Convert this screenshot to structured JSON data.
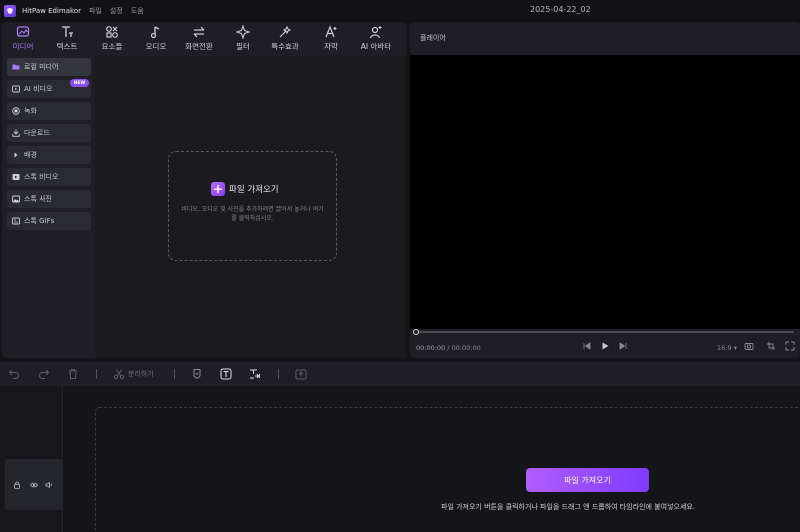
{
  "titlebar": {
    "app_name": "HitPaw Edimakor",
    "menu": [
      "파일",
      "설정",
      "도움"
    ],
    "project_name": "2025-04-22_02"
  },
  "toolbar": {
    "tabs": [
      {
        "label": "미디어",
        "icon": "media-icon",
        "active": true
      },
      {
        "label": "텍스트",
        "icon": "text-icon",
        "active": false
      },
      {
        "label": "요소들",
        "icon": "elements-icon",
        "active": false
      },
      {
        "label": "오디오",
        "icon": "audio-icon",
        "active": false
      },
      {
        "label": "화면전환",
        "icon": "transition-icon",
        "active": false
      },
      {
        "label": "필터",
        "icon": "filter-icon",
        "active": false
      },
      {
        "label": "특수효과",
        "icon": "effects-icon",
        "active": false
      },
      {
        "label": "자막",
        "icon": "subtitle-icon",
        "active": false
      },
      {
        "label": "AI 아바타",
        "icon": "ai-avatar-icon",
        "active": false
      }
    ]
  },
  "sidenav": {
    "items": [
      {
        "label": "로컬 미디어",
        "icon": "folder-icon",
        "active": true
      },
      {
        "label": "AI 비디오",
        "icon": "ai-video-icon",
        "active": false
      },
      {
        "label": "녹화",
        "icon": "record-icon",
        "active": false
      },
      {
        "label": "다운로드",
        "icon": "download-icon",
        "active": false
      },
      {
        "label": "배경",
        "icon": "background-icon",
        "active": false
      },
      {
        "label": "스톡 비디오",
        "icon": "stock-video-icon",
        "active": false
      },
      {
        "label": "스톡 사진",
        "icon": "stock-photo-icon",
        "active": false
      },
      {
        "label": "스톡 GIFs",
        "icon": "gif-icon",
        "active": false
      }
    ],
    "new_badge": "NEW"
  },
  "media": {
    "import_label": "파일 가져오기",
    "hint": "비디오, 오디오 및 사진을 추가하려면 끌어서 놓거나 여기를 클릭하십시오."
  },
  "player": {
    "title": "플레이어",
    "current_time": "00:00:00",
    "separator": " / ",
    "total_time": "00:00:00",
    "aspect_ratio": "16:9",
    "progress": 0
  },
  "timeline": {
    "split_label": "분리하기",
    "import_label": "파일 가져오기",
    "hint": "파일 가져오기 버튼을 클릭하거나 파일을 드래그 앤 드롭하여 타임라인에 붙여넣으세요."
  },
  "colors": {
    "accent": "#a97bff",
    "button_gradient_start": "#b15dff",
    "button_gradient_end": "#7f3bff",
    "panel": "#1e1e24",
    "background": "#141419"
  }
}
